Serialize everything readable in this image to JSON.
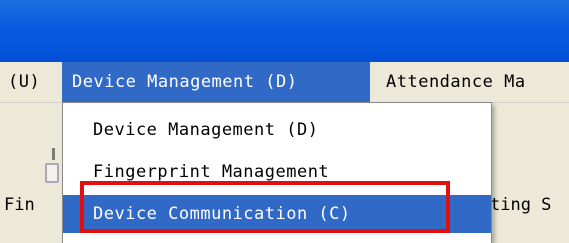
{
  "menubar": {
    "prev_item": "(U)",
    "active_item": "Device Management  (D)",
    "next_item": "Attendance Ma"
  },
  "toolbar": {
    "left_text": "Fin",
    "right_text": "ting  S"
  },
  "dropdown": {
    "items": [
      "Device Management  (D)",
      "Fingerprint Management",
      "Device Communication  (C)"
    ],
    "highlighted_index": 2
  },
  "colors": {
    "titlebar": "#0a5ae0",
    "menubar_bg": "#ece9d8",
    "selection": "#3169c6",
    "annotation_box": "#e01010"
  }
}
